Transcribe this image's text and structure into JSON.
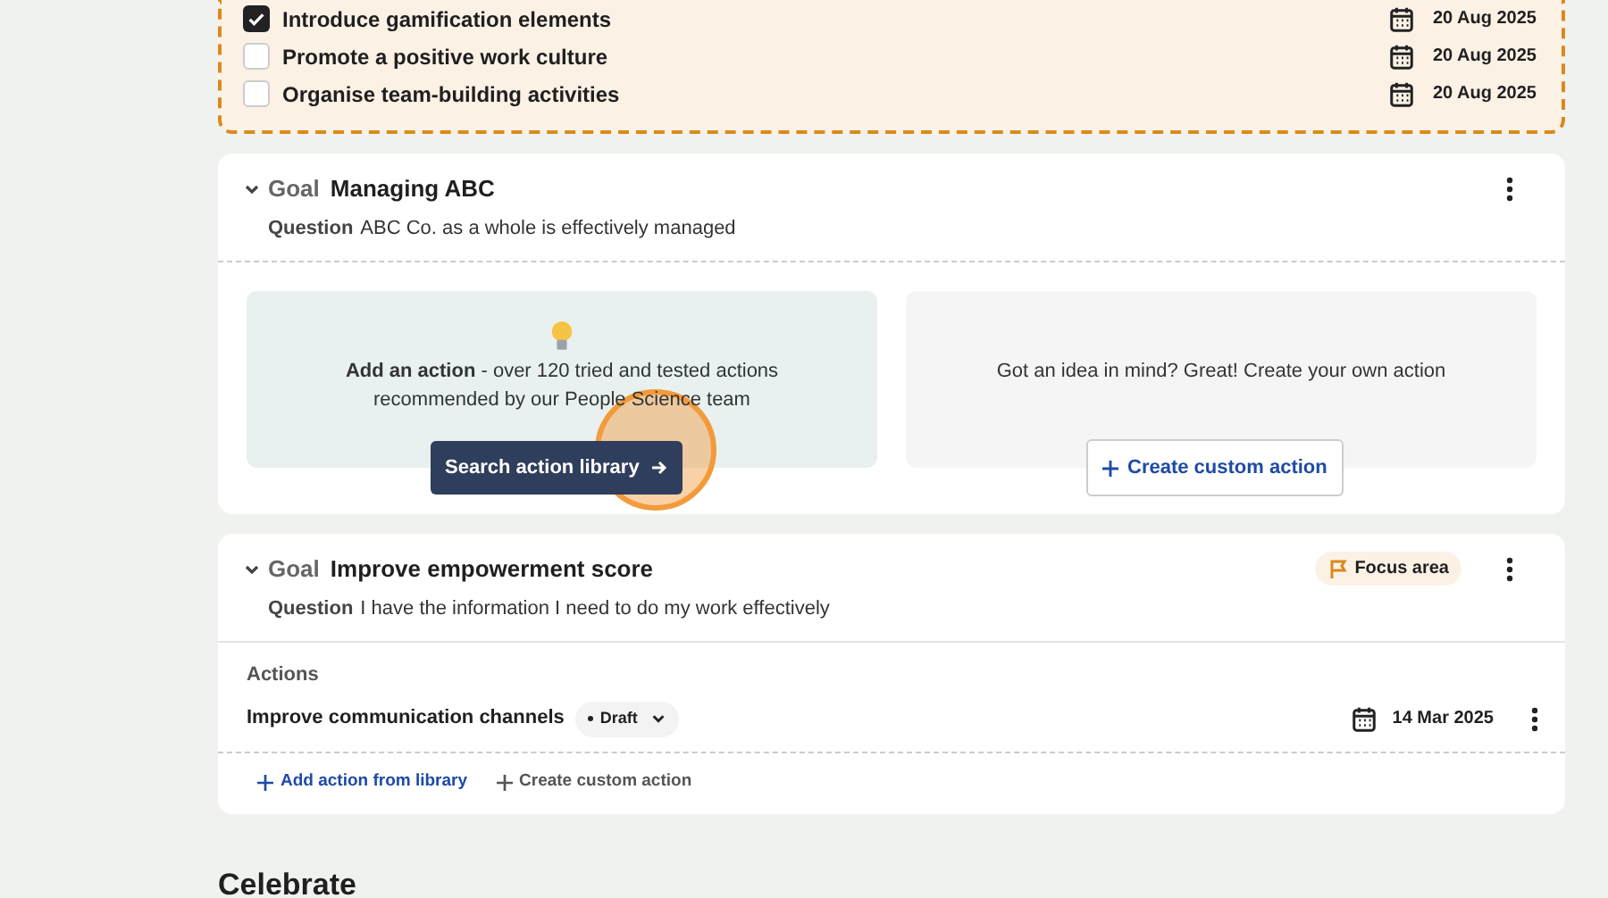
{
  "top_actions": [
    {
      "label": "Introduce gamification elements",
      "checked": true,
      "date": "20 Aug 2025"
    },
    {
      "label": "Promote a positive work culture",
      "checked": false,
      "date": "20 Aug 2025"
    },
    {
      "label": "Organise team-building activities",
      "checked": false,
      "date": "20 Aug 2025"
    }
  ],
  "goals": [
    {
      "kind": "library_prompt",
      "expanded": true,
      "goal_label": "Goal",
      "title": "Managing ABC",
      "question_label": "Question",
      "question": "ABC Co. as a whole is effectively managed",
      "library": {
        "text": "**Add an action** - over 120 tried and tested actions recommended by our People Science team",
        "button": "Search action library"
      },
      "custom": {
        "text": "Got an idea in mind? Great! Create your own action",
        "button": "Create custom action"
      }
    },
    {
      "kind": "actions",
      "expanded": true,
      "goal_label": "Goal",
      "title": "Improve empowerment score",
      "question_label": "Question",
      "question": "I have the information I need to do my work effectively",
      "focus_area": "Focus area",
      "actions_heading": "Actions",
      "actions": [
        {
          "label": "Improve communication channels",
          "status": "Draft",
          "date": "14 Mar 2025"
        }
      ],
      "footer_links": [
        "Add action from library",
        "Create custom action"
      ]
    }
  ],
  "section_heading": "Celebrate"
}
